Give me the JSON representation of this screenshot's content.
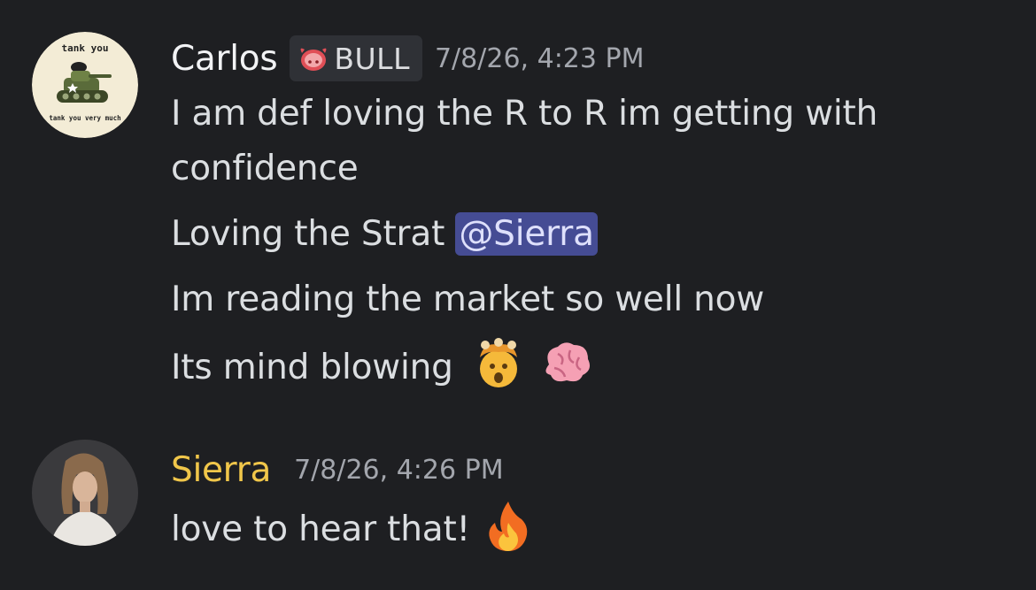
{
  "messages": [
    {
      "author": "Carlos",
      "role_tag": "BULL",
      "timestamp": "7/8/26, 4:23 PM",
      "avatar_text_top": "tank you",
      "avatar_text_bottom": "tank you very much",
      "lines": [
        "I am def loving the R to R im getting with",
        "confidence",
        "Loving the Strat ",
        "Im reading the market so well now",
        "Its mind blowing"
      ],
      "mention": "@Sierra",
      "emojis": [
        "exploding-head-emoji",
        "brain-emoji"
      ]
    },
    {
      "author": "Sierra",
      "timestamp": "7/8/26, 4:26 PM",
      "lines": [
        "love to hear that!"
      ],
      "emojis": [
        "fire-emoji"
      ]
    }
  ],
  "colors": {
    "background": "#1e1f22",
    "username_default": "#f2f3f5",
    "username_sierra": "#f0c64a",
    "mention_bg": "#454c94",
    "text": "#dbdee1",
    "timestamp": "#a3a6ad"
  }
}
